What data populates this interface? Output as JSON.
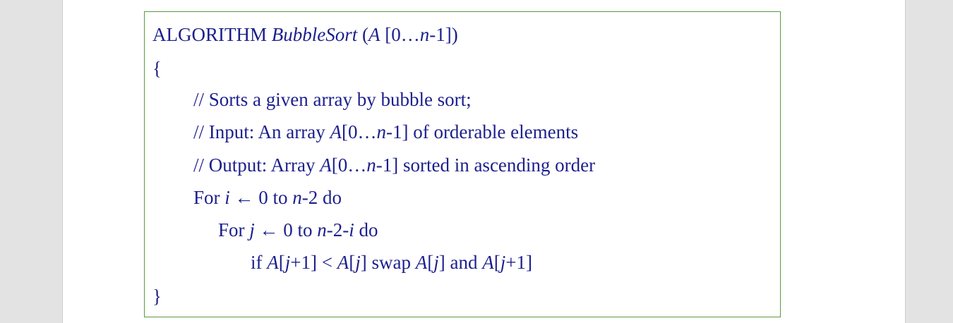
{
  "algorithm": {
    "header": {
      "keyword": "ALGORITHM ",
      "name": "BubbleSort",
      "p1": " (",
      "A": "A",
      "p2": " [0…",
      "n": "n",
      "p3": "-1])"
    },
    "open_brace": "{",
    "comment_1": "// Sorts a given array by bubble sort;",
    "comment_2": {
      "p1": "// Input: An array ",
      "A": "A",
      "p2": "[0…",
      "n": "n",
      "p3": "-1] of orderable elements"
    },
    "comment_3": {
      "p1": "// Output: Array ",
      "A": "A",
      "p2": "[0…",
      "n": "n",
      "p3": "-1] sorted in ascending order"
    },
    "loop_outer": {
      "for": "For ",
      "i": "i",
      "arrow": " ← ",
      "from": "0 to ",
      "n": "n",
      "rest": "-2  do"
    },
    "loop_inner": {
      "for": "For ",
      "j": "j",
      "arrow": " ← ",
      "from": "0 to ",
      "n": "n",
      "mid": "-2-",
      "i": "i",
      "rest": " do"
    },
    "swap_line": {
      "if": "if  ",
      "A1": "A",
      "b1": "[",
      "j1": "j",
      "b2": "+1] < ",
      "A2": "A",
      "b3": "[",
      "j2": "j",
      "b4": "]   swap ",
      "A3": "A",
      "b5": "[",
      "j3": "j",
      "b6": "] and ",
      "A4": "A",
      "b7": "[",
      "j4": "j",
      "b8": "+1]"
    },
    "close_brace": "}"
  },
  "colors": {
    "text": "#1c1f8c",
    "box_border": "#5a9a3c"
  }
}
